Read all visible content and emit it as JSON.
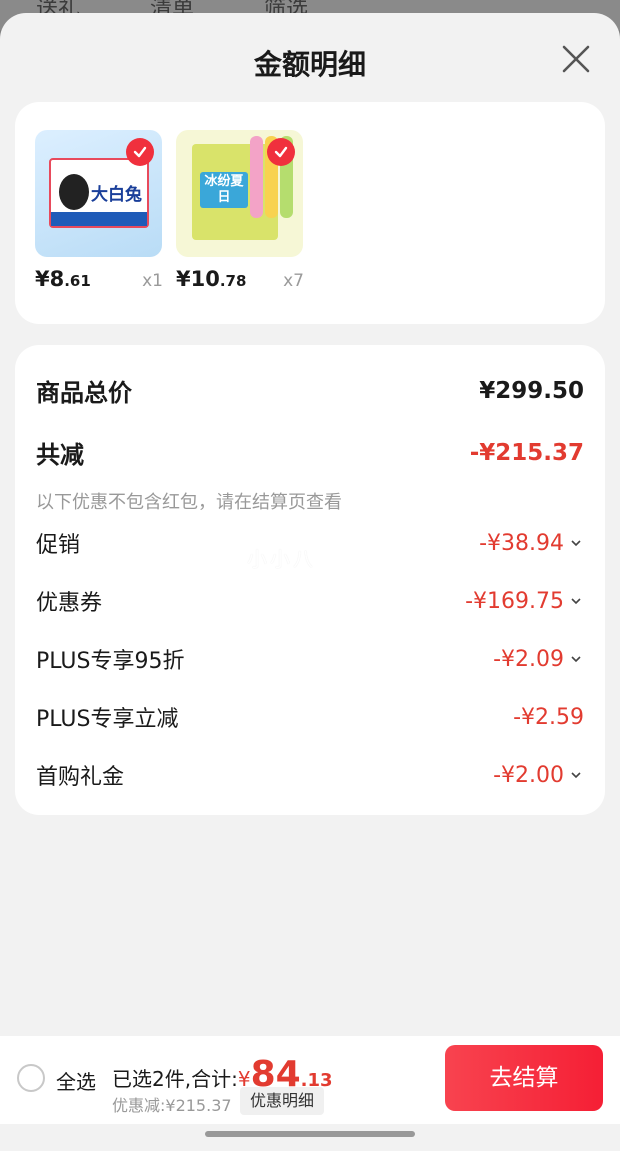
{
  "background": {
    "tabs": [
      "送礼",
      "清单",
      "筛选"
    ]
  },
  "sheet": {
    "title": "金额明细"
  },
  "products": [
    {
      "price_int": "¥8",
      "price_dec": ".61",
      "qty": "x1",
      "image": "大白兔 ice cream box",
      "box_brand": "大白兔"
    },
    {
      "price_int": "¥10",
      "price_dec": ".78",
      "qty": "x7",
      "image": "冰份夏日 popsicle box",
      "box_label": "冰纷夏日"
    }
  ],
  "summary": {
    "total_label": "商品总价",
    "total_value": "¥299.50",
    "reduce_label": "共减",
    "reduce_value": "-¥215.37",
    "note": "以下优惠不包含红包，请在结算页查看",
    "items": [
      {
        "label": "促销",
        "value": "-¥38.94",
        "has_chevron": true
      },
      {
        "label": "优惠券",
        "value": "-¥169.75",
        "has_chevron": true
      },
      {
        "label": "PLUS专享95折",
        "value": "-¥2.09",
        "has_chevron": true
      },
      {
        "label": "PLUS专享立减",
        "value": "-¥2.59",
        "has_chevron": false
      },
      {
        "label": "首购礼金",
        "value": "-¥2.00",
        "has_chevron": true
      }
    ]
  },
  "watermark": "小小八",
  "footer": {
    "select_all": "全选",
    "selected_text": "已选2件,合计:",
    "total_currency": "¥",
    "total_int": "84",
    "total_dec": ".13",
    "discount_text": "优惠减:¥215.37",
    "detail_button": "优惠明细",
    "checkout_button": "去结算"
  },
  "colors": {
    "accent_red": "#e23b30",
    "checkout_red": "#f5303f"
  }
}
